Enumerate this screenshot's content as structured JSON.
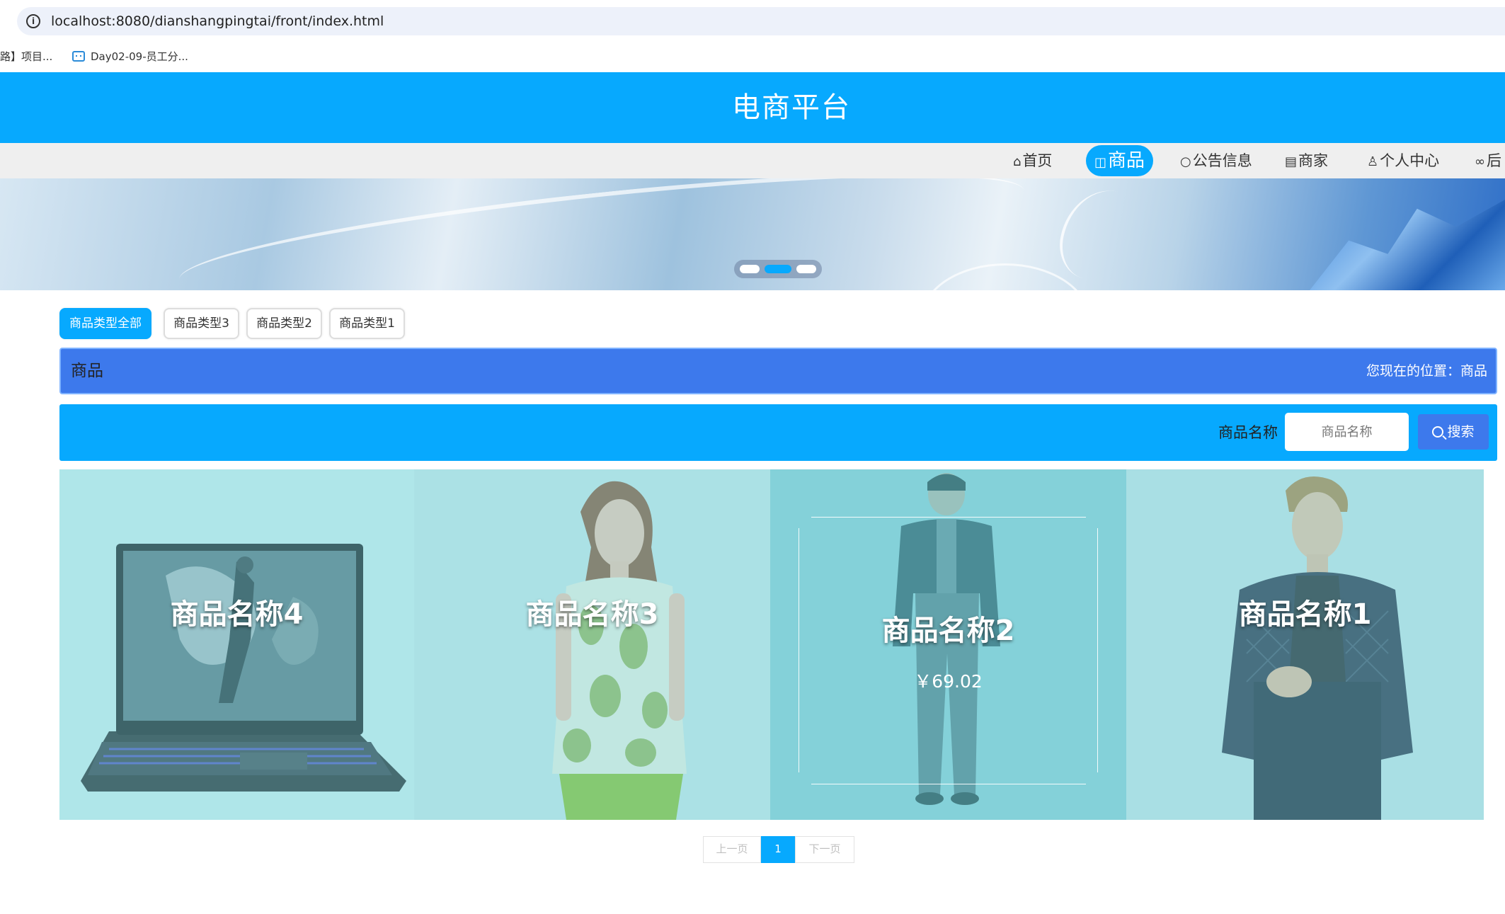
{
  "browser": {
    "url": "localhost:8080/dianshangpingtai/front/index.html",
    "bookmarks": [
      "路】项目...",
      "Day02-09-员工分..."
    ]
  },
  "site": {
    "title": "电商平台"
  },
  "nav": {
    "items": [
      {
        "label": "首页",
        "icon": "home-icon"
      },
      {
        "label": "商品",
        "icon": "goods-icon",
        "active": true
      },
      {
        "label": "公告信息",
        "icon": "chat-icon"
      },
      {
        "label": "商家",
        "icon": "store-icon"
      },
      {
        "label": "个人中心",
        "icon": "user-icon"
      },
      {
        "label": "后",
        "icon": "link-icon"
      }
    ]
  },
  "carousel": {
    "count": 3,
    "active_index": 1
  },
  "categories": [
    {
      "label": "商品类型全部",
      "active": true
    },
    {
      "label": "商品类型3"
    },
    {
      "label": "商品类型2"
    },
    {
      "label": "商品类型1"
    }
  ],
  "title_bar": {
    "title": "商品",
    "breadcrumb": "您现在的位置：商品"
  },
  "search": {
    "label": "商品名称",
    "placeholder": "商品名称",
    "button": "搜索"
  },
  "products": [
    {
      "name": "商品名称4",
      "image": "laptop"
    },
    {
      "name": "商品名称3",
      "image": "woman-floral-top"
    },
    {
      "name": "商品名称2",
      "price": "￥69.02",
      "image": "man-dark-jacket",
      "hovered": true
    },
    {
      "name": "商品名称1",
      "image": "man-quilted-jacket"
    }
  ],
  "pagination": {
    "prev": "上一页",
    "current": "1",
    "next": "下一页"
  },
  "colors": {
    "primary": "#07a9fe",
    "accent": "#3d79ec",
    "nav_bg": "#efefef"
  }
}
